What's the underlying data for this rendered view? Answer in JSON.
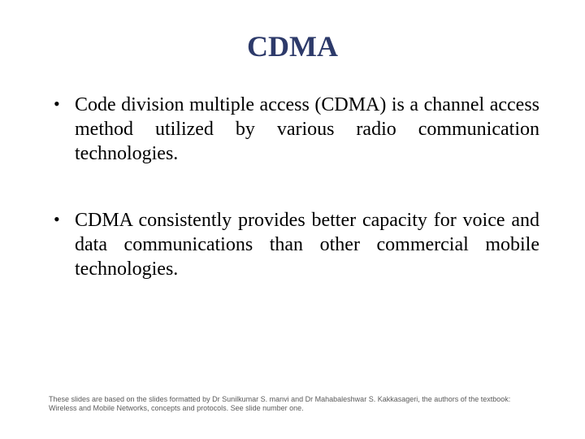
{
  "title": "CDMA",
  "bullets": [
    "Code division multiple access (CDMA) is a channel access method utilized by various radio communication technologies.",
    "CDMA consistently provides better capacity for voice and data communications than other commercial mobile technologies."
  ],
  "footer": "These slides are based on the slides formatted by Dr Sunilkumar S. manvi and Dr Mahabaleshwar S. Kakkasageri, the authors of the textbook: Wireless and Mobile Networks, concepts and protocols. See slide number one."
}
